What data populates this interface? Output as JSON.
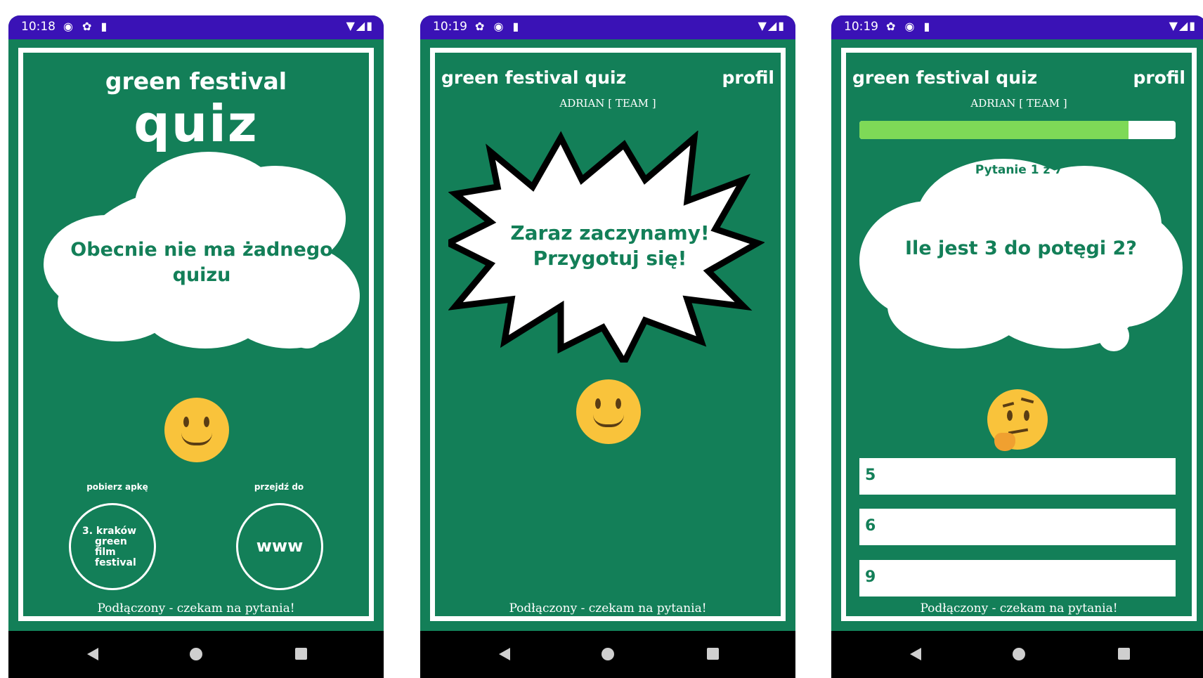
{
  "phones": [
    {
      "status": {
        "time": "10:18",
        "icons": "◉ ✿ ▮",
        "right": "▼◢▮"
      },
      "title_line1": "green festival",
      "title_line2": "quiz",
      "cloud_text": "Obecnie nie ma żadnego quizu",
      "left_label": "pobierz  apkę",
      "right_label": "przejdź do",
      "logo_lines": [
        "3. kraków",
        "green",
        "film",
        "festival"
      ],
      "www_label": "www",
      "footer": "Podłączony - czekam na pytania!"
    },
    {
      "status": {
        "time": "10:19",
        "icons": "✿ ◉ ▮",
        "right": "▼◢▮"
      },
      "title": "green festival quiz",
      "profile": "profil",
      "user": "ADRIAN [ TEAM ]",
      "burst_text_1": "Zaraz zaczynamy!",
      "burst_text_2": "Przygotuj się!",
      "footer": "Podłączony - czekam na pytania!"
    },
    {
      "status": {
        "time": "10:19",
        "icons": "✿ ◉ ▮",
        "right": "▼◢▮"
      },
      "title": "green festival quiz",
      "profile": "profil",
      "user": "ADRIAN [ TEAM ]",
      "progress": 0.85,
      "question_counter": "Pytanie 1 z 7",
      "question": "Ile jest 3 do potęgi 2?",
      "answers": [
        "5",
        "6",
        "9"
      ],
      "footer": "Podłączony - czekam na pytania!"
    }
  ],
  "colors": {
    "app_bg": "#137f58",
    "status_bar": "#3a12b6",
    "progress_fill": "#7ed957",
    "emoji": "#f9c33b"
  },
  "icons": [
    "back-icon",
    "home-icon",
    "recents-icon",
    "smiley-emoji",
    "thinking-emoji",
    "wifi-icon",
    "signal-icon",
    "battery-icon"
  ]
}
